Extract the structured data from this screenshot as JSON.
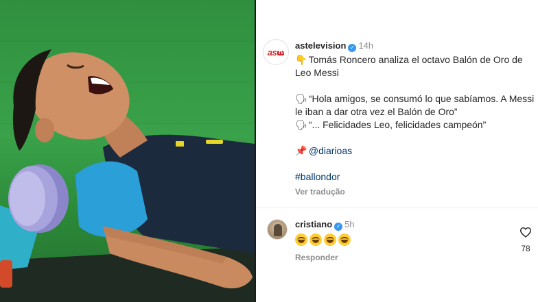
{
  "post": {
    "username": "astelevision",
    "verified": true,
    "time": "14h",
    "caption_line1_emoji": "point-down-emoji",
    "caption_line1": "Tomás Roncero analiza el octavo Balón de Oro de Leo Messi",
    "quote1_emoji": "speaking-head-emoji",
    "quote1": "“Hola amigos, se consumó lo que sabíamos. A Messi le iban a dar otra vez el Balón de Oro”",
    "quote2_emoji": "speaking-head-emoji",
    "quote2": "“... Felicidades Leo, felicidades campeón”",
    "pin_emoji": "pushpin-emoji",
    "mention": "@diarioas",
    "hashtag": "#ballondor",
    "see_translation": "Ver tradução"
  },
  "comment": {
    "username": "cristiano",
    "verified": true,
    "time": "5h",
    "emojis": [
      "joy-emoji",
      "joy-emoji",
      "joy-emoji",
      "joy-emoji"
    ],
    "reply_label": "Responder",
    "like_count": "78",
    "like_icon": "heart-outline-icon"
  },
  "colors": {
    "link": "#00376b",
    "muted": "#8e8e8e",
    "verified": "#3897f0",
    "brand_red": "#d8252b"
  }
}
